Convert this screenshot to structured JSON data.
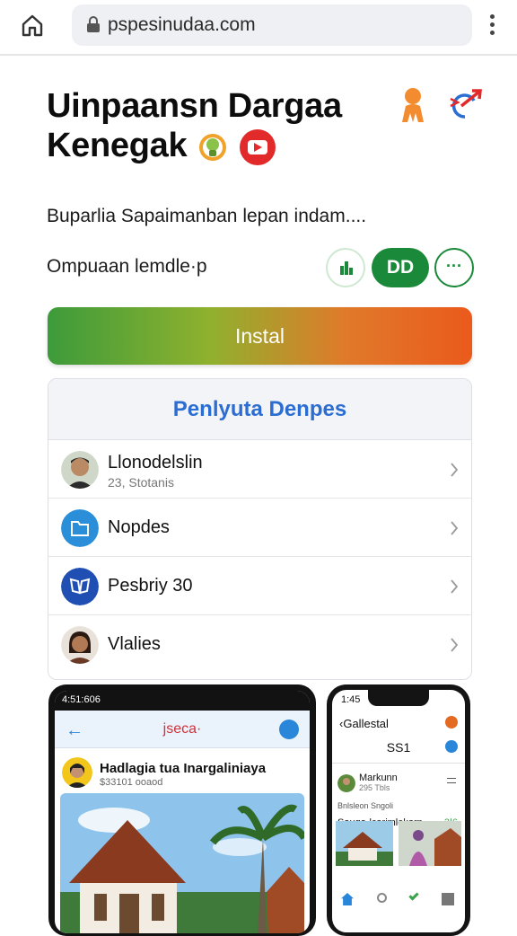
{
  "browser": {
    "url": "pspesinudaa.com",
    "icons": [
      "home-icon",
      "lock-icon",
      "more-vert-icon"
    ]
  },
  "app": {
    "title_line1": "Uinpaansn Dargaa",
    "title_line2": "Kenegak",
    "subtitle": "Buparlia Sapaimanban lepan indam....",
    "meta": "Ompuaan lemdle·p",
    "chip_dd": "DD",
    "chip_more": "···",
    "install_label": "Instal",
    "accent": "#1a8a3a",
    "install_gradient": [
      "#3d9b3b",
      "#8fb12e",
      "#e07a2a",
      "#ea5a1c"
    ]
  },
  "card": {
    "header": "Penlyuta Denpes",
    "header_color": "#2c6dd1",
    "rows": [
      {
        "label": "Llonodelslin",
        "sub": "23, Stotanis",
        "icon": "avatar-man"
      },
      {
        "label": "Nopdes",
        "sub": "",
        "icon": "folder-icon"
      },
      {
        "label": "Pesbriy 30",
        "sub": "",
        "icon": "book-icon"
      },
      {
        "label": "Vlalies",
        "sub": "",
        "icon": "avatar-woman"
      }
    ]
  },
  "phone1": {
    "status_time": "4:51:606",
    "title": "jseca·",
    "post_name": "Hadlagia tua Inargaliniaya",
    "post_sub": "$33101 ooaod"
  },
  "phone2": {
    "status_time": "1:45",
    "back_label": "Gallestal",
    "heading": "SS1",
    "user_name": "Markunn",
    "user_sub": "295 Tbls",
    "meta_line": "Bnlsleon Sngoli",
    "caption": "Sauga-lcarimlekorn",
    "caption_count": "3|6"
  }
}
